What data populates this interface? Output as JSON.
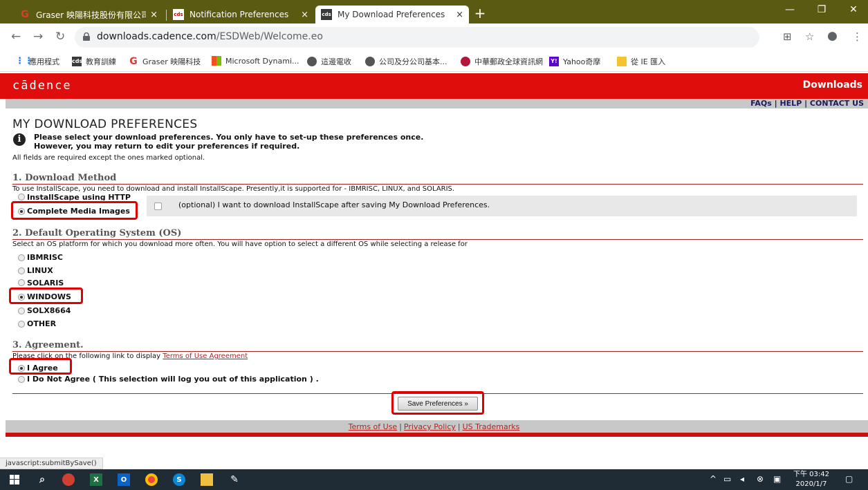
{
  "browser": {
    "tabs": [
      {
        "title": "Graser 映陽科技股份有限公司"
      },
      {
        "title": "Notification Preferences"
      },
      {
        "title": "My Download Preferences"
      }
    ],
    "url_domain": "downloads.cadence.com",
    "url_path": "/ESDWeb/Welcome.eo",
    "bookmarks": [
      "應用程式",
      "教育訓練",
      "Graser 映陽科技",
      "Microsoft Dynami...",
      "這邊電收",
      "公司及分公司基本...",
      "中華郵政全球資訊網",
      "Yahoo奇摩",
      "從 IE 匯入"
    ],
    "close_glyph": "×",
    "newtab_glyph": "+"
  },
  "header": {
    "logo": "cādence",
    "downloads": "Downloads",
    "links": "FAQs | HELP | CONTACT US"
  },
  "page": {
    "title": "MY DOWNLOAD PREFERENCES",
    "intro_line1": "Please select your download preferences. You only have to set-up these preferences once.",
    "intro_line2": "However, you may return to edit your preferences if required.",
    "required_note": "All fields are required except the ones marked optional."
  },
  "section1": {
    "heading": "1. Download Method",
    "description": "To use InstallScape, you need to download and install InstallScape. Presently,it is supported for - IBMRISC, LINUX, and SOLARIS.",
    "option_installscape": "InstallScape using HTTP",
    "option_complete": "Complete Media Images",
    "optional_checkbox": "(optional) I want to download InstallScape after saving My Download Preferences."
  },
  "section2": {
    "heading": "2. Default Operating System (OS)",
    "description": "Select an OS platform for which you download more often. You will have option to select a different OS while selecting a release for",
    "options": [
      "IBMRISC",
      "LINUX",
      "SOLARIS",
      "WINDOWS",
      "SOLX8664",
      "OTHER"
    ],
    "selected": "WINDOWS"
  },
  "section3": {
    "heading": "3. Agreement.",
    "description": "Please click on the following link to display",
    "link": "Terms of Use Agreement",
    "agree": "I Agree",
    "disagree": "I Do Not Agree ( This selection will log you out of this application ) ."
  },
  "save_button": "Save Preferences »",
  "footer": {
    "terms": "Terms of Use",
    "privacy": "Privacy Policy",
    "trademarks": "US Trademarks",
    "separator": "|"
  },
  "status_bar": "javascript:submitBySave()",
  "taskbar": {
    "time": "下午 03:42",
    "date": "2020/1/7"
  },
  "colors": {
    "cadence_red": "#e00d0d",
    "tab_bar": "#5a5a12",
    "highlight": "#e00000",
    "taskbar": "#1f2b35"
  }
}
